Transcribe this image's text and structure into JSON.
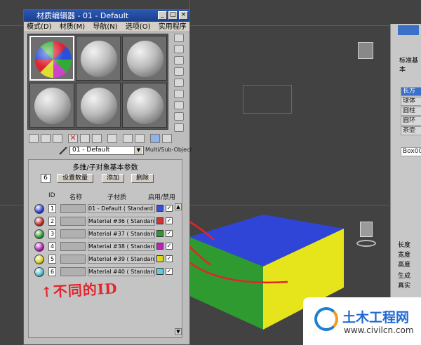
{
  "window": {
    "title": "材质编辑器 - 01 - Default",
    "menu": [
      "模式(D)",
      "材质(M)",
      "导航(N)",
      "选项(O)",
      "实用程序(U)"
    ]
  },
  "material_name": "01 - Default",
  "material_type": "Multi/Sub-Object",
  "rollout": {
    "title": "多维/子对象基本参数",
    "count": "6",
    "set_count_label": "设置数量",
    "add_label": "添加",
    "delete_label": "删除",
    "col_id": "ID",
    "col_name": "名称",
    "col_submat": "子材质",
    "col_onoff": "启用/禁用",
    "rows": [
      {
        "id": "1",
        "material": "01 - Default  ( Standard )",
        "color": "#3a4ee0",
        "ball": "#2a3fd8",
        "checked": "✓"
      },
      {
        "id": "2",
        "material": "Material #36  ( Standard )",
        "color": "#d23232",
        "ball": "#c42a2a",
        "checked": "✓"
      },
      {
        "id": "3",
        "material": "Material #37  ( Standard )",
        "color": "#2e9a2e",
        "ball": "#2a9a2a",
        "checked": "✓"
      },
      {
        "id": "4",
        "material": "Material #38  ( Standard )",
        "color": "#c020c0",
        "ball": "#b51eb5",
        "checked": "✓"
      },
      {
        "id": "5",
        "material": "Material #39  ( Standard )",
        "color": "#e0d820",
        "ball": "#d7cf1d",
        "checked": "✓"
      },
      {
        "id": "6",
        "material": "Material #40  ( Standard )",
        "color": "#60d0d8",
        "ball": "#4dbfc8",
        "checked": "✓"
      }
    ]
  },
  "command_panel": {
    "label_standard": "标准基本",
    "items": [
      "长方",
      "球体",
      "圆柱",
      "圆环",
      "茶壶"
    ],
    "name_field": "Box001",
    "labels": [
      "长度",
      "宽度",
      "高度",
      "生成",
      "真实"
    ]
  },
  "annotation": "↑不同的ID",
  "watermark": {
    "title": "土木工程网",
    "url": "www.civilcn.com"
  },
  "colors": {
    "face_top": "#2f45d8",
    "face_left": "#2f9a2f",
    "face_right": "#e6e41a"
  }
}
